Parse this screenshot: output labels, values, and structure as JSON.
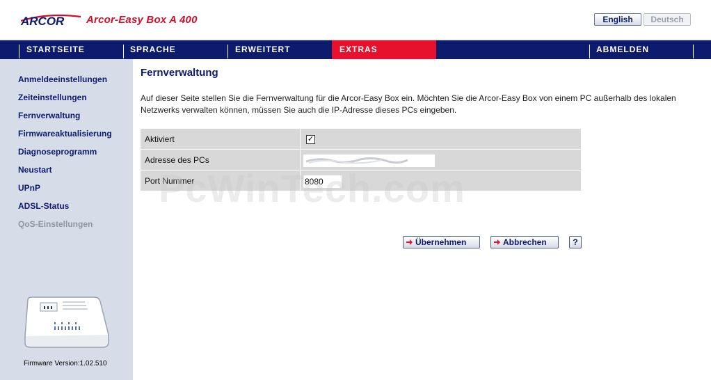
{
  "header": {
    "brand": "ARCOR",
    "product_title": "Arcor-Easy Box A 400",
    "languages": [
      {
        "label": "English",
        "active": true
      },
      {
        "label": "Deutsch",
        "active": false
      }
    ]
  },
  "nav": {
    "items": [
      "STARTSEITE",
      "SPRACHE",
      "ERWEITERT",
      "EXTRAS",
      "ABMELDEN"
    ],
    "active": "EXTRAS"
  },
  "sidebar": {
    "items": [
      {
        "label": "Anmeldeeinstellungen",
        "enabled": true
      },
      {
        "label": "Zeiteinstellungen",
        "enabled": true
      },
      {
        "label": "Fernverwaltung",
        "enabled": true
      },
      {
        "label": "Firmwareaktualisierung",
        "enabled": true
      },
      {
        "label": "Diagnoseprogramm",
        "enabled": true
      },
      {
        "label": "Neustart",
        "enabled": true
      },
      {
        "label": "UPnP",
        "enabled": true
      },
      {
        "label": "ADSL-Status",
        "enabled": true
      },
      {
        "label": "QoS-Einstellungen",
        "enabled": false
      }
    ],
    "firmware": "Firmware Version:1.02.510"
  },
  "main": {
    "title": "Fernverwaltung",
    "description": "Auf dieser Seite stellen Sie die Fernverwaltung für die Arcor-Easy Box ein. Möchten Sie die Arcor-Easy Box von einem PC außerhalb des lokalen Netzwerks verwalten können, müssen Sie auch die IP-Adresse dieses PCs eingeben.",
    "fields": {
      "activated_label": "Aktiviert",
      "activated_checked": true,
      "activated_mark": "✓",
      "address_label": "Adresse des PCs",
      "address_value": "",
      "port_label": "Port Nummer",
      "port_value": "8080"
    },
    "buttons": {
      "apply": "Übernehmen",
      "cancel": "Abbrechen",
      "help": "?"
    }
  },
  "watermark": "PcWinTech.com",
  "colors": {
    "nav_bg": "#0d1b6e",
    "nav_active": "#e8112d",
    "brand_red": "#d0102a",
    "sidebar_bg": "#d6dde8",
    "table_bg": "#d8d8d8"
  },
  "icons": {
    "button_arrow": "arrow-right-icon",
    "device": "router-device-icon"
  }
}
